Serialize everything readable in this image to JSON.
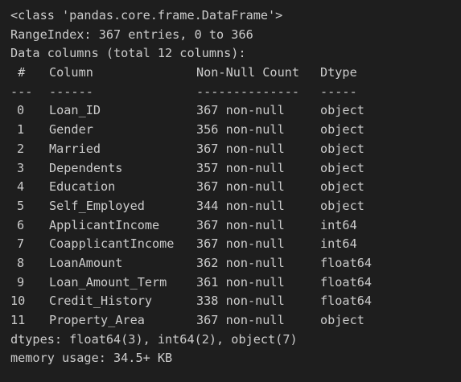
{
  "output": {
    "class_line": "<class 'pandas.core.frame.DataFrame'>",
    "range_index": "RangeIndex: 367 entries, 0 to 366",
    "data_columns": "Data columns (total 12 columns):",
    "header": {
      "num": " #",
      "column": "Column",
      "non_null": "Non-Null Count",
      "dtype": "Dtype"
    },
    "separator": {
      "num": "---",
      "column": "------",
      "non_null": "--------------",
      "dtype": "-----"
    },
    "rows": [
      {
        "num": "0",
        "column": "Loan_ID",
        "non_null": "367 non-null",
        "dtype": "object"
      },
      {
        "num": "1",
        "column": "Gender",
        "non_null": "356 non-null",
        "dtype": "object"
      },
      {
        "num": "2",
        "column": "Married",
        "non_null": "367 non-null",
        "dtype": "object"
      },
      {
        "num": "3",
        "column": "Dependents",
        "non_null": "357 non-null",
        "dtype": "object"
      },
      {
        "num": "4",
        "column": "Education",
        "non_null": "367 non-null",
        "dtype": "object"
      },
      {
        "num": "5",
        "column": "Self_Employed",
        "non_null": "344 non-null",
        "dtype": "object"
      },
      {
        "num": "6",
        "column": "ApplicantIncome",
        "non_null": "367 non-null",
        "dtype": "int64"
      },
      {
        "num": "7",
        "column": "CoapplicantIncome",
        "non_null": "367 non-null",
        "dtype": "int64"
      },
      {
        "num": "8",
        "column": "LoanAmount",
        "non_null": "362 non-null",
        "dtype": "float64"
      },
      {
        "num": "9",
        "column": "Loan_Amount_Term",
        "non_null": "361 non-null",
        "dtype": "float64"
      },
      {
        "num": "10",
        "column": "Credit_History",
        "non_null": "338 non-null",
        "dtype": "float64"
      },
      {
        "num": "11",
        "column": "Property_Area",
        "non_null": "367 non-null",
        "dtype": "object"
      }
    ],
    "dtypes_line": "dtypes: float64(3), int64(2), object(7)",
    "memory_line": "memory usage: 34.5+ KB"
  },
  "colors": {
    "background": "#1e1e1e",
    "text": "#cccccc"
  }
}
